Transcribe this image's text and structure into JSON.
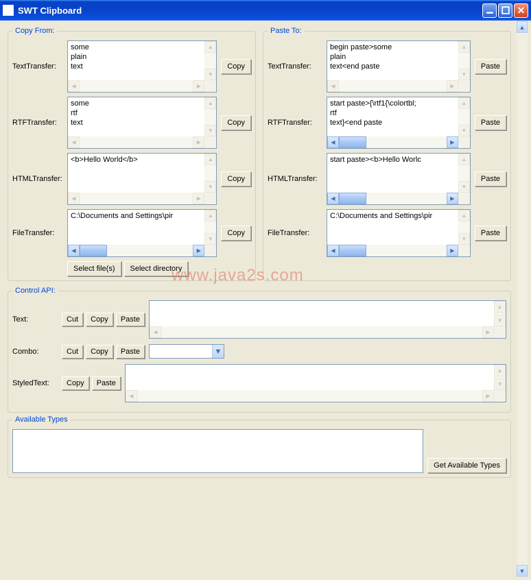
{
  "window": {
    "title": "SWT Clipboard"
  },
  "copyFrom": {
    "legend": "Copy From:",
    "text": {
      "label": "TextTransfer:",
      "value": "some\nplain\ntext",
      "button": "Copy"
    },
    "rtf": {
      "label": "RTFTransfer:",
      "value": "some\nrtf\ntext",
      "button": "Copy"
    },
    "html": {
      "label": "HTMLTransfer:",
      "value": "<b>Hello World</b>",
      "button": "Copy"
    },
    "file": {
      "label": "FileTransfer:",
      "value": "C:\\Documents and Settings\\pir",
      "button": "Copy",
      "selectFiles": "Select file(s)",
      "selectDir": "Select directory"
    }
  },
  "pasteTo": {
    "legend": "Paste To:",
    "text": {
      "label": "TextTransfer:",
      "value": "begin paste>some\nplain\ntext<end paste",
      "button": "Paste"
    },
    "rtf": {
      "label": "RTFTransfer:",
      "value": "start paste>{\\rtf1{\\colortbl;\nrtf\ntext}<end paste",
      "button": "Paste"
    },
    "html": {
      "label": "HTMLTransfer:",
      "value": "start paste><b>Hello Worlc",
      "button": "Paste"
    },
    "file": {
      "label": "FileTransfer:",
      "value": "C:\\Documents and Settings\\pir",
      "button": "Paste"
    }
  },
  "controlApi": {
    "legend": "Control API:",
    "text": {
      "label": "Text:",
      "cut": "Cut",
      "copy": "Copy",
      "paste": "Paste"
    },
    "combo": {
      "label": "Combo:",
      "cut": "Cut",
      "copy": "Copy",
      "paste": "Paste",
      "value": ""
    },
    "styled": {
      "label": "StyledText:",
      "copy": "Copy",
      "paste": "Paste"
    }
  },
  "availableTypes": {
    "legend": "Available Types",
    "button": "Get Available Types"
  },
  "watermark": "www.java2s.com"
}
